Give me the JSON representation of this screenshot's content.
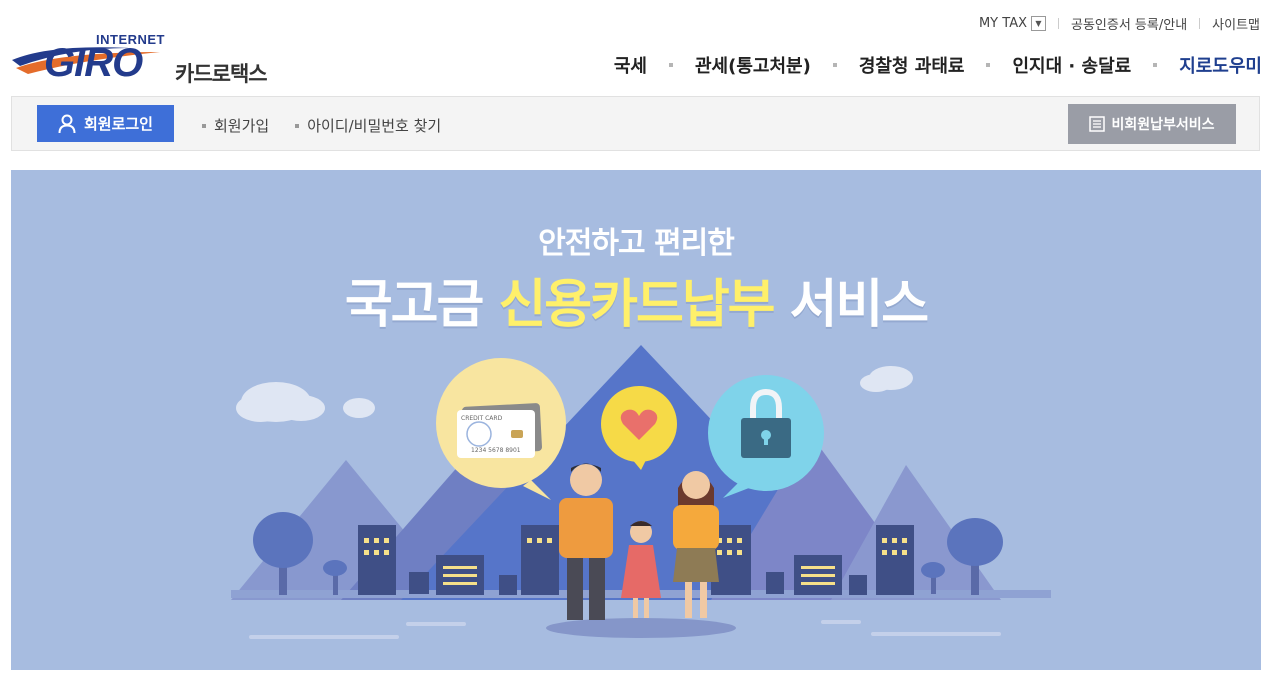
{
  "header": {
    "logo": {
      "internet": "INTERNET",
      "giro": "GIRO",
      "service_name": "카드로택스"
    },
    "utility_links": [
      {
        "label": "MY TAX"
      },
      {
        "label": "공동인증서 등록/안내"
      },
      {
        "label": "사이트맵"
      }
    ],
    "gnb": [
      {
        "label": "국세"
      },
      {
        "label": "관세(통고처분)"
      },
      {
        "label": "경찰청 과태료"
      },
      {
        "label": "인지대 · 송달료"
      },
      {
        "label": "지로도우미"
      }
    ]
  },
  "loginbar": {
    "login_button": "회원로그인",
    "links": [
      {
        "label": "회원가입"
      },
      {
        "label": "아이디/비밀번호 찾기"
      }
    ],
    "nonmember_button": "비회원납부서비스"
  },
  "banner": {
    "subtitle": "안전하고 편리한",
    "title_part1": "국고금 ",
    "title_highlight": "신용카드납부",
    "title_part2": " 서비스",
    "card_text": "CREDIT CARD",
    "card_number": "1234 5678 8901"
  },
  "colors": {
    "brand_navy": "#233b8c",
    "login_blue": "#3e6fd8",
    "banner_bg": "#a7bce0",
    "highlight_yellow": "#fff06a",
    "nonmember_gray": "#9a9da6"
  },
  "icons": [
    "user-icon",
    "list-icon",
    "dropdown-arrow-icon",
    "lock-icon",
    "heart-icon",
    "credit-card-icon"
  ]
}
